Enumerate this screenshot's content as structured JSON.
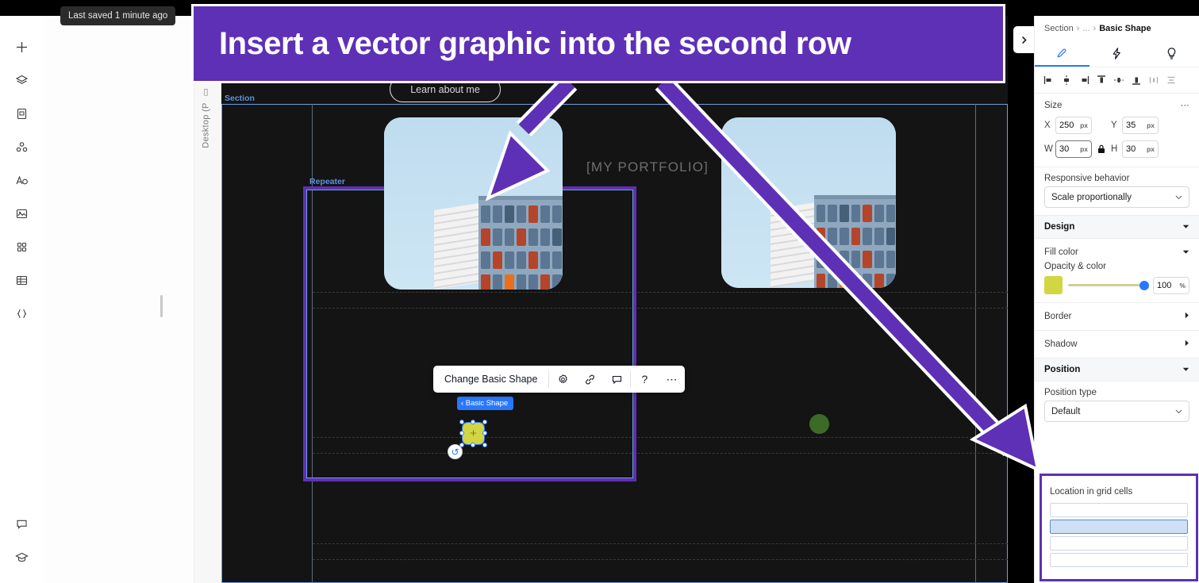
{
  "banner": {
    "text": "Insert a vector graphic into the second row",
    "bg": "#5e30b5"
  },
  "toast": {
    "text": "Last saved 1 minute ago"
  },
  "left_rail": {
    "items": [
      {
        "name": "add-icon",
        "glyph": "+"
      },
      {
        "name": "layers-icon",
        "glyph": "◈"
      },
      {
        "name": "page-icon",
        "glyph": "▤"
      },
      {
        "name": "apps-icon",
        "glyph": "⚘"
      },
      {
        "name": "text-icon",
        "glyph": "A"
      },
      {
        "name": "media-icon",
        "glyph": "⛰"
      },
      {
        "name": "sections-icon",
        "glyph": "∷"
      },
      {
        "name": "table-icon",
        "glyph": "▦"
      },
      {
        "name": "code-icon",
        "glyph": "{ }"
      }
    ],
    "bottom": [
      {
        "name": "comment-icon",
        "glyph": "⬚"
      },
      {
        "name": "learn-icon",
        "glyph": "⌂"
      }
    ]
  },
  "canvas": {
    "device_label": "Desktop (P",
    "section_tag": "Section",
    "repeater_tag": "Repeater",
    "learn_button": "Learn about me",
    "portfolio_title": "[MY PORTFOLIO]"
  },
  "float_toolbar": {
    "label": "Change Basic Shape",
    "icons": [
      {
        "name": "settings-gear-icon",
        "glyph": "⚙"
      },
      {
        "name": "link-icon",
        "glyph": "🔗"
      },
      {
        "name": "comment-icon",
        "glyph": "⬚"
      },
      {
        "name": "help-icon",
        "glyph": "?"
      },
      {
        "name": "more-options-icon",
        "glyph": "⋯"
      }
    ]
  },
  "shape": {
    "breadcrumb_chip": "‹ Basic Shape",
    "reset_icon": "↺",
    "plus": "+",
    "fill_hex": "#d2d642",
    "second_row_fill_hex": "#3b6b26"
  },
  "right_panel": {
    "breadcrumb": {
      "root": "Section",
      "ellipsis": "...",
      "current": "Basic Shape",
      "sep": "›"
    },
    "tabs": [
      {
        "name": "tab-design",
        "glyph": "✎",
        "active": true
      },
      {
        "name": "tab-interactions",
        "glyph": "⚡",
        "active": false
      },
      {
        "name": "tab-tips",
        "glyph": "♀",
        "active": false
      }
    ],
    "align_icons": [
      {
        "name": "align-left-icon",
        "glyph": "⊢"
      },
      {
        "name": "align-center-horizontal-icon",
        "glyph": "⌶"
      },
      {
        "name": "align-right-icon",
        "glyph": "⊣"
      },
      {
        "name": "align-top-icon",
        "glyph": "⊤"
      },
      {
        "name": "align-middle-vertical-icon",
        "glyph": "⊹"
      },
      {
        "name": "align-bottom-icon",
        "glyph": "⊥"
      },
      {
        "name": "distribute-horizontal-icon",
        "glyph": "‖"
      },
      {
        "name": "distribute-vertical-icon",
        "glyph": "≡"
      }
    ],
    "size": {
      "title": "Size",
      "more": "···",
      "x_label": "X",
      "x_value": "250",
      "x_unit": "px",
      "y_label": "Y",
      "y_value": "35",
      "y_unit": "px",
      "w_label": "W",
      "w_value": "30",
      "w_unit": "px",
      "h_label": "H",
      "h_value": "30",
      "h_unit": "px",
      "lock_icon": "🔒"
    },
    "responsive": {
      "label": "Responsive behavior",
      "value": "Scale proportionally"
    },
    "design": {
      "title": "Design",
      "fill_color_label": "Fill color",
      "opacity_label": "Opacity & color",
      "opacity_value": "100",
      "opacity_unit": "%",
      "border_label": "Border",
      "shadow_label": "Shadow"
    },
    "position": {
      "title": "Position",
      "type_label": "Position type",
      "type_value": "Default",
      "grid_label": "Location in grid cells",
      "cells": [
        {
          "selected": false
        },
        {
          "selected": true
        },
        {
          "selected": false
        },
        {
          "selected": false
        }
      ]
    }
  },
  "expand_button": {
    "glyph": "›"
  }
}
